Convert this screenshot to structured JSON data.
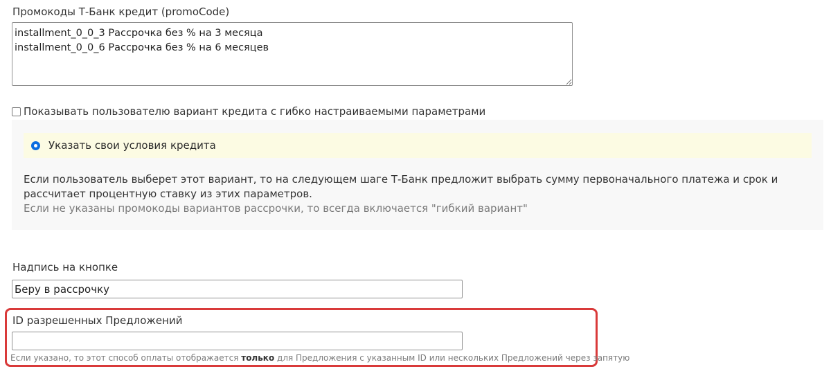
{
  "promo": {
    "label": "Промокоды Т-Банк кредит (promoCode)",
    "value": "installment_0_0_3 Рассрочка без % на 3 месяца\ninstallment_0_0_6 Рассрочка без % на 6 месяцев"
  },
  "flexible": {
    "checkbox_label": "Показывать пользователю вариант кредита с гибко настраиваемыми параметрами",
    "checked": false,
    "option_label": "Указать свои условия кредита",
    "option_selected": true,
    "description": "Если пользователь выберет этот вариант, то на следующем шаге Т-Банк предложит выбрать сумму первоначального платежа и срок и рассчитает процентную ставку из этих параметров.",
    "note": "Если не указаны промокоды вариантов рассрочки, то всегда включается \"гибкий вариант\""
  },
  "button_text": {
    "label": "Надпись на кнопке",
    "value": "Беру в рассрочку"
  },
  "allowed_offers": {
    "label": "ID разрешенных Предложений",
    "value": "",
    "hint_before": "Если указано, то этот способ оплаты отображается ",
    "hint_bold": "только",
    "hint_after": " для Предложения с указанным ID или нескольких Предложений через запятую",
    "highlight_color": "#d93a3a"
  },
  "colors": {
    "radio_accent": "#0b6ee0",
    "option_background": "#fcfbe3",
    "panel_background": "#f8f8f8"
  }
}
